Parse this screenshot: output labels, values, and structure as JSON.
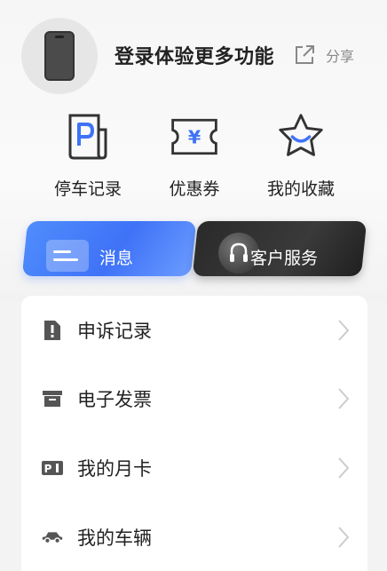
{
  "profile": {
    "login_prompt": "登录体验更多功能",
    "share_label": "分享"
  },
  "quick_actions": [
    {
      "label": "停车记录",
      "icon": "parking-receipt-icon"
    },
    {
      "label": "优惠券",
      "icon": "coupon-icon"
    },
    {
      "label": "我的收藏",
      "icon": "star-icon"
    }
  ],
  "cards": {
    "message_label": "消息",
    "service_label": "客户服务"
  },
  "menu": [
    {
      "label": "申诉记录",
      "icon": "alert-document-icon"
    },
    {
      "label": "电子发票",
      "icon": "invoice-box-icon"
    },
    {
      "label": "我的月卡",
      "icon": "parking-card-icon"
    },
    {
      "label": "我的车辆",
      "icon": "car-icon"
    }
  ],
  "colors": {
    "accent_blue": "#3f72f7",
    "dark_card": "#2a2a2a",
    "icon_gray": "#555555"
  }
}
